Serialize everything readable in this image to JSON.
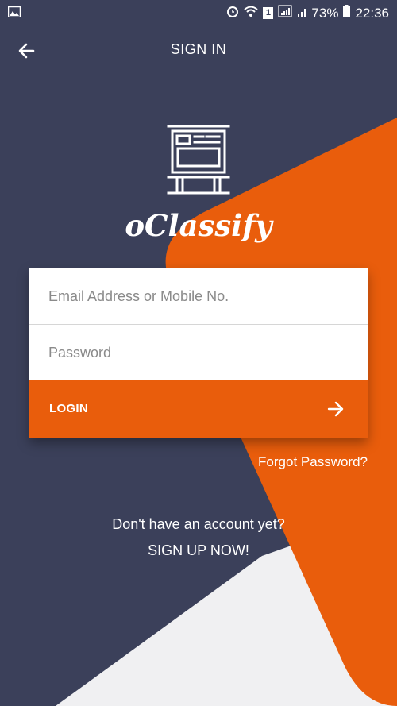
{
  "status_bar": {
    "battery": "73%",
    "time": "22:36",
    "sim_slot": "1"
  },
  "header": {
    "title": "SIGN IN"
  },
  "brand": {
    "name": "oClassify"
  },
  "form": {
    "email_placeholder": "Email Address or Mobile No.",
    "email_value": "",
    "password_placeholder": "Password",
    "password_value": "",
    "login_label": "LOGIN",
    "forgot_label": "Forgot Password?"
  },
  "signup": {
    "prompt": "Don't have an account yet?",
    "cta": "SIGN UP NOW!"
  },
  "colors": {
    "background": "#3b405a",
    "accent": "#e95d0c",
    "light": "#f0f0f2"
  },
  "icons": {
    "back": "arrow-left-icon",
    "login": "arrow-right-icon",
    "logo": "kiosk-board-icon"
  }
}
